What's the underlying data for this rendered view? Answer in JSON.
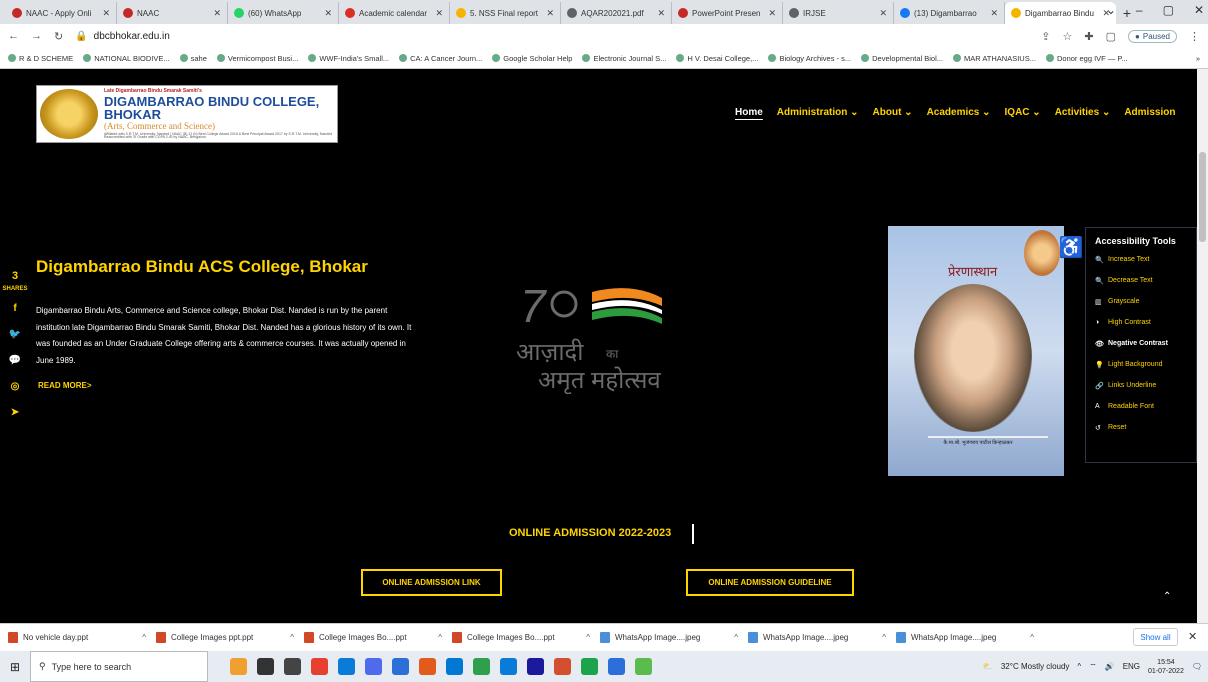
{
  "browser": {
    "tabs": [
      {
        "label": "NAAC - Apply Onli",
        "color": "#c62828"
      },
      {
        "label": "NAAC",
        "color": "#c62828"
      },
      {
        "label": "(60) WhatsApp",
        "color": "#25d366"
      },
      {
        "label": "Academic calendar",
        "color": "#d93025"
      },
      {
        "label": "5. NSS Final report",
        "color": "#f4b400"
      },
      {
        "label": "AQAR202021.pdf",
        "color": "#5f6368"
      },
      {
        "label": "PowerPoint Presen",
        "color": "#c62828"
      },
      {
        "label": "IRJSE",
        "color": "#5f6368"
      },
      {
        "label": "(13) Digambarrao",
        "color": "#1877f2"
      },
      {
        "label": "Digambarrao Bindu",
        "color": "#f4b400"
      }
    ],
    "new_tab": "+",
    "window_controls": [
      "⌄",
      "–",
      "▢",
      "✕"
    ],
    "url": "dbcbhokar.edu.in",
    "profile_status": "Paused",
    "bookmarks": [
      "R & D SCHEME",
      "NATIONAL BIODIVE...",
      "sahe",
      "Vermicompost Busi...",
      "WWF-India's Small...",
      "CA: A Cancer Journ...",
      "Google Scholar Help",
      "Electronic Journal S...",
      "H V. Desai College,...",
      "Biology Archives - s...",
      "Developmental Biol...",
      "MAR ATHANASIUS...",
      "Donor egg IVF — P..."
    ],
    "bookmarks_more": "»"
  },
  "site": {
    "logo": {
      "line1": "Late Digambarrao Bindu Smarak Samiti's",
      "line2": "DIGAMBARRAO BINDU COLLEGE, BHOKAR",
      "line3": "(Arts, Commerce and Science)",
      "line4": "Affiliated with S.R.T.M. University, Nanded | NAAC (B) 12 (b) Best College Award 2018 & Best Principal Award 2017 by S.R.T.M. University, Nanded Reaccredited with 'B' Grade with CGPA 2.40 by NAAC, Bengaluru"
    },
    "nav": [
      {
        "label": "Home",
        "active": true
      },
      {
        "label": "Administration ⌄",
        "active": false
      },
      {
        "label": "About ⌄",
        "active": false
      },
      {
        "label": "Academics ⌄",
        "active": false
      },
      {
        "label": "IQAC ⌄",
        "active": false
      },
      {
        "label": "Activities ⌄",
        "active": false
      },
      {
        "label": "Admission",
        "active": false
      }
    ],
    "share": {
      "count": "3",
      "label": "SHARES",
      "icons": [
        "f",
        "🐦",
        "💬",
        "◎",
        "➤"
      ]
    },
    "hero": {
      "title": "Digambarrao Bindu ACS College, Bhokar",
      "text": "Digambarrao Bindu Arts, Commerce and Science college, Bhokar Dist. Nanded is run by the parent institution late Digambarrao Bindu Smarak Samiti, Bhokar Dist. Nanded has a glorious history of its own. It was founded as an Under Graduate College offering arts & commerce courses. It was actually opened in June 1989.",
      "read_more": "READ MORE>"
    },
    "azadi": {
      "line1": "आज़ादी",
      "ka": "का",
      "line2": "अमृत महोत्सव"
    },
    "book": {
      "title": "प्रेरणास्थान",
      "caption": "कै.मा.श्री. भुजंगराव पाटील किन्हाळकर",
      "sub": "प्रेरणास्थान"
    },
    "accessibility": {
      "title": "Accessibility Tools",
      "items": [
        {
          "icon": "🔍",
          "label": "Increase Text"
        },
        {
          "icon": "🔍",
          "label": "Decrease Text"
        },
        {
          "icon": "▥",
          "label": "Grayscale"
        },
        {
          "icon": "◑",
          "label": "High Contrast"
        },
        {
          "icon": "👁",
          "label": "Negative Contrast"
        },
        {
          "icon": "💡",
          "label": "Light Background"
        },
        {
          "icon": "🔗",
          "label": "Links Underline"
        },
        {
          "icon": "A",
          "label": "Readable Font"
        },
        {
          "icon": "↺",
          "label": "Reset"
        }
      ]
    },
    "admission": {
      "title": "ONLINE ADMISSION 2022-2023",
      "link_button": "ONLINE ADMISSION LINK",
      "guideline_button": "ONLINE ADMISSION GUIDELINE"
    }
  },
  "downloads": {
    "items": [
      {
        "label": "No vehicle day.ppt",
        "type": "ppt"
      },
      {
        "label": "College Images ppt.ppt",
        "type": "ppt"
      },
      {
        "label": "College Images Bo....ppt",
        "type": "ppt"
      },
      {
        "label": "College Images Bo....ppt",
        "type": "ppt"
      },
      {
        "label": "WhatsApp Image....jpeg",
        "type": "img"
      },
      {
        "label": "WhatsApp Image....jpeg",
        "type": "img"
      },
      {
        "label": "WhatsApp Image....jpeg",
        "type": "img"
      }
    ],
    "show_all": "Show all"
  },
  "taskbar": {
    "search_placeholder": "Type here to search",
    "weather": "32°C  Mostly cloudy",
    "lang": "ENG",
    "time": "15:54",
    "date": "01-07-2022",
    "app_colors": [
      "#f0a030",
      "#333",
      "#444",
      "#e7402f",
      "#0a7bd6",
      "#4f6bed",
      "#2d6fd9",
      "#e35a1d",
      "#0078d4",
      "#2e9f4a",
      "#0a7bd6",
      "#1a1a9a",
      "#d34f2f",
      "#1ca34c",
      "#2d6fd9",
      "#5bbc4e"
    ]
  }
}
